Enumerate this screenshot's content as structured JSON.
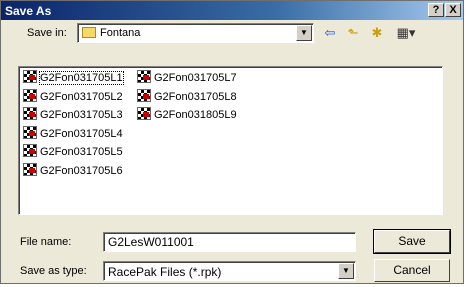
{
  "window": {
    "title": "Save As",
    "help_label": "?",
    "close_label": "X"
  },
  "save_in": {
    "label": "Save in:",
    "value": "Fontana"
  },
  "toolbar": {
    "back_icon": "back-arrow-icon",
    "up_icon": "up-folder-icon",
    "new_folder_icon": "new-folder-icon",
    "view_icon": "view-menu-icon"
  },
  "files": [
    {
      "name": "G2Fon031705L1",
      "selected": true
    },
    {
      "name": "G2Fon031705L2"
    },
    {
      "name": "G2Fon031705L3"
    },
    {
      "name": "G2Fon031705L4"
    },
    {
      "name": "G2Fon031705L5"
    },
    {
      "name": "G2Fon031705L6"
    },
    {
      "name": "G2Fon031705L7"
    },
    {
      "name": "G2Fon031705L8"
    },
    {
      "name": "G2Fon031805L9"
    }
  ],
  "file_name": {
    "label": "File name:",
    "value": "G2LesW011001"
  },
  "save_as_type": {
    "label": "Save as type:",
    "value": "RacePak Files (*.rpk)"
  },
  "buttons": {
    "save": "Save",
    "cancel": "Cancel"
  }
}
